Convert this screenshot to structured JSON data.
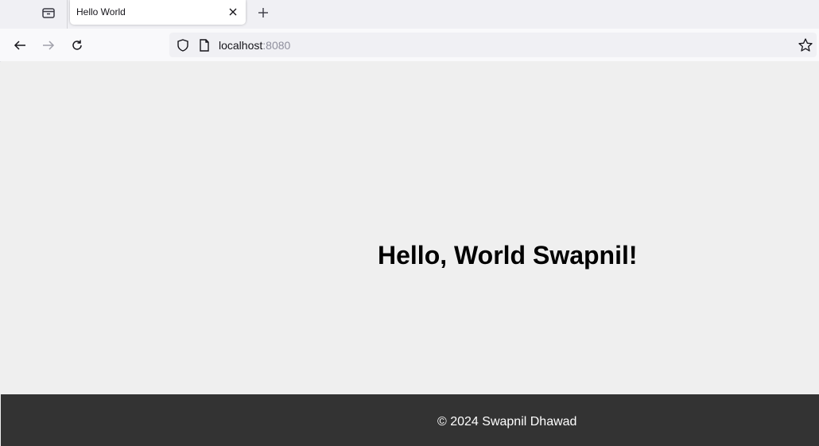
{
  "browser": {
    "tab": {
      "title": "Hello World"
    },
    "address": {
      "host": "localhost",
      "port": ":8080"
    },
    "icons": {
      "tab_list": "tab-list-icon",
      "close": "close-icon",
      "new_tab": "plus-icon",
      "back": "back-arrow-icon",
      "forward": "forward-arrow-icon",
      "reload": "reload-icon",
      "shield": "shield-icon",
      "page": "page-icon",
      "bookmark": "star-icon"
    }
  },
  "page": {
    "heading": "Hello, World Swapnil!",
    "footer": "© 2024 Swapnil Dhawad"
  },
  "colors": {
    "content_bg": "#efefef",
    "footer_bg": "#333333",
    "footer_text": "#ffffff"
  }
}
